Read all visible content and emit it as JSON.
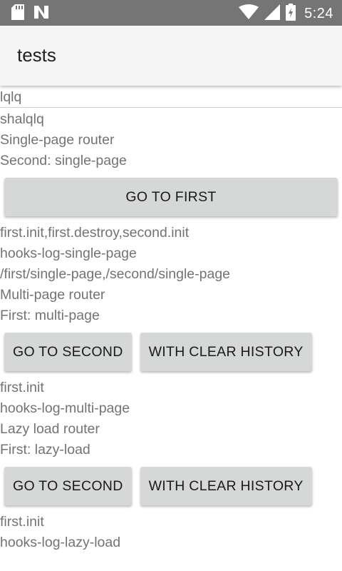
{
  "status_bar": {
    "time": "5:24",
    "icons": [
      "sd-card-icon",
      "n-notification-icon",
      "wifi-icon",
      "signal-icon",
      "battery-icon"
    ]
  },
  "app_bar": {
    "title": "tests"
  },
  "content": {
    "header_line": "lqlq",
    "sub_line": "shalqlq",
    "single": {
      "heading": "Single-page router",
      "current": "Second: single-page",
      "button": "GO TO FIRST",
      "log": "first.init,first.destroy,second.init",
      "hooks_label": "hooks-log-single-page",
      "history": "/first/single-page,/second/single-page"
    },
    "multi": {
      "heading": "Multi-page router",
      "current": "First: multi-page",
      "button_second": "GO TO SECOND",
      "button_clear": "WITH CLEAR HISTORY",
      "log": "first.init",
      "hooks_label": "hooks-log-multi-page"
    },
    "lazy": {
      "heading": "Lazy load router",
      "current": "First: lazy-load",
      "button_second": "GO TO SECOND",
      "button_clear": "WITH CLEAR HISTORY",
      "log": "first.init",
      "hooks_label": "hooks-log-lazy-load"
    }
  }
}
